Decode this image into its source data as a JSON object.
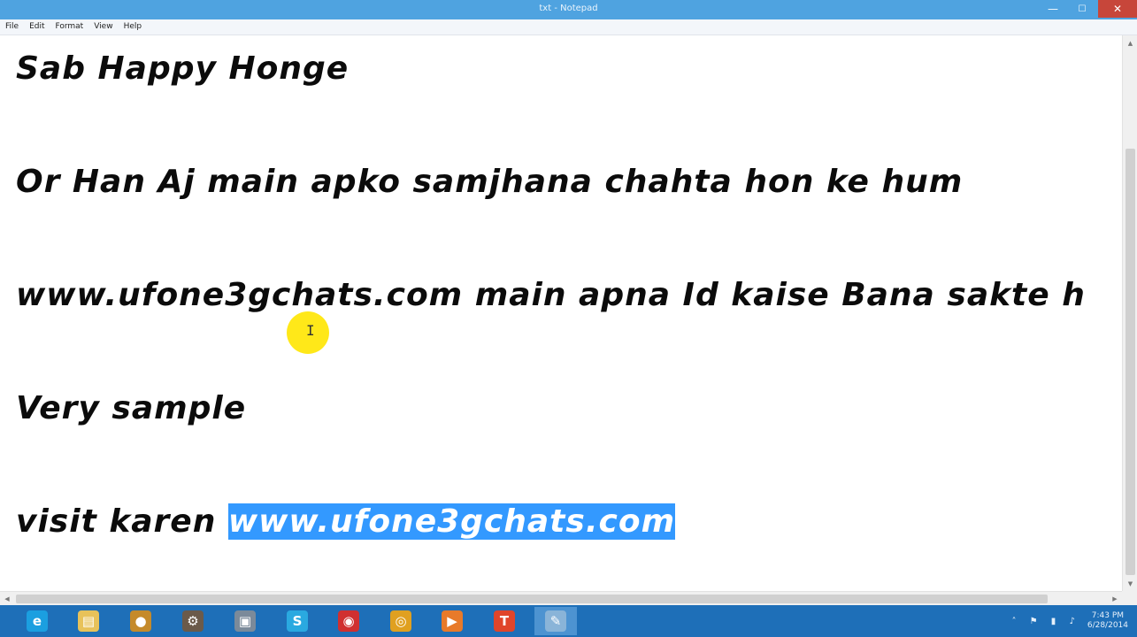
{
  "window": {
    "title": "txt - Notepad",
    "minimize_glyph": "—",
    "maximize_glyph": "☐",
    "close_glyph": "✕"
  },
  "menu": [
    {
      "label": "File"
    },
    {
      "label": "Edit"
    },
    {
      "label": "Format"
    },
    {
      "label": "View"
    },
    {
      "label": "Help"
    }
  ],
  "document": {
    "lines": [
      {
        "text": "Sab Happy Honge"
      },
      {
        "text": "Or Han Aj main apko samjhana chahta hon ke hum"
      },
      {
        "text": "www.ufone3gchats.com main apna Id kaise Bana sakte h"
      },
      {
        "text": "Very sample"
      },
      {
        "text": "visit karen ",
        "selected": "www.ufone3gchats.com"
      }
    ]
  },
  "taskbar": {
    "apps": [
      {
        "icon": "internet-explorer-icon",
        "glyph": "e",
        "color": "#1b9fe0"
      },
      {
        "icon": "file-explorer-icon",
        "glyph": "▤",
        "color": "#e8c25a"
      },
      {
        "icon": "media-app-icon",
        "glyph": "●",
        "color": "#c58a2a"
      },
      {
        "icon": "gear-app-icon",
        "glyph": "⚙",
        "color": "#6b5a4a"
      },
      {
        "icon": "photo-app-icon",
        "glyph": "▣",
        "color": "#7b8a9a"
      },
      {
        "icon": "skype-icon",
        "glyph": "S",
        "color": "#2aa9e0"
      },
      {
        "icon": "record-app-icon",
        "glyph": "◉",
        "color": "#d03030"
      },
      {
        "icon": "chrome-icon",
        "glyph": "◎",
        "color": "#e0a020"
      },
      {
        "icon": "media-player-icon",
        "glyph": "▶",
        "color": "#e87a2a"
      },
      {
        "icon": "t-app-icon",
        "glyph": "T",
        "color": "#e0452a"
      },
      {
        "icon": "notepad-icon",
        "glyph": "✎",
        "color": "#8ab4d8"
      }
    ],
    "tray_icons": "˄ ⚑ ▮ ♪",
    "clock_time": "7:43 PM",
    "clock_date": "6/28/2014"
  }
}
